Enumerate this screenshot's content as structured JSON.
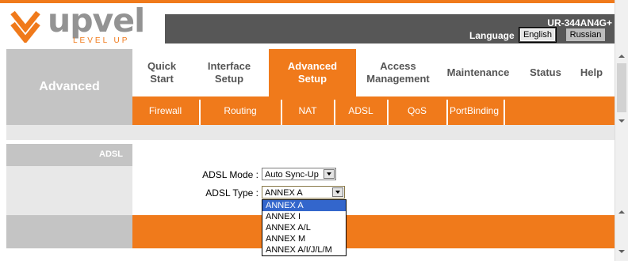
{
  "header": {
    "brand": "upvel",
    "tagline": "LEVEL UP",
    "model": "UR-344AN4G+",
    "language_label": "Language",
    "languages": [
      "English",
      "Russian"
    ],
    "selected_language": "English"
  },
  "section_title": "Advanced",
  "main_nav": [
    {
      "label": "Quick\nStart",
      "active": false
    },
    {
      "label": "Interface\nSetup",
      "active": false
    },
    {
      "label": "Advanced\nSetup",
      "active": true
    },
    {
      "label": "Access\nManagement",
      "active": false
    },
    {
      "label": "Maintenance",
      "active": false
    },
    {
      "label": "Status",
      "active": false
    },
    {
      "label": "Help",
      "active": false
    }
  ],
  "sub_nav": [
    "Firewall",
    "Routing",
    "NAT",
    "ADSL",
    "QoS",
    "PortBinding"
  ],
  "sub_nav_active": "ADSL",
  "content": {
    "side_label": "ADSL",
    "adsl_mode_label": "ADSL Mode :",
    "adsl_mode_value": "Auto Sync-Up",
    "adsl_type_label": "ADSL Type :",
    "adsl_type_value": "ANNEX A",
    "adsl_type_options": [
      "ANNEX A",
      "ANNEX I",
      "ANNEX A/L",
      "ANNEX M",
      "ANNEX A/I/J/L/M"
    ]
  },
  "colors": {
    "accent": "#f07a1b",
    "dark_header": "#575757",
    "sidebar_gray": "#c4c4c4",
    "selection": "#3366cc"
  }
}
